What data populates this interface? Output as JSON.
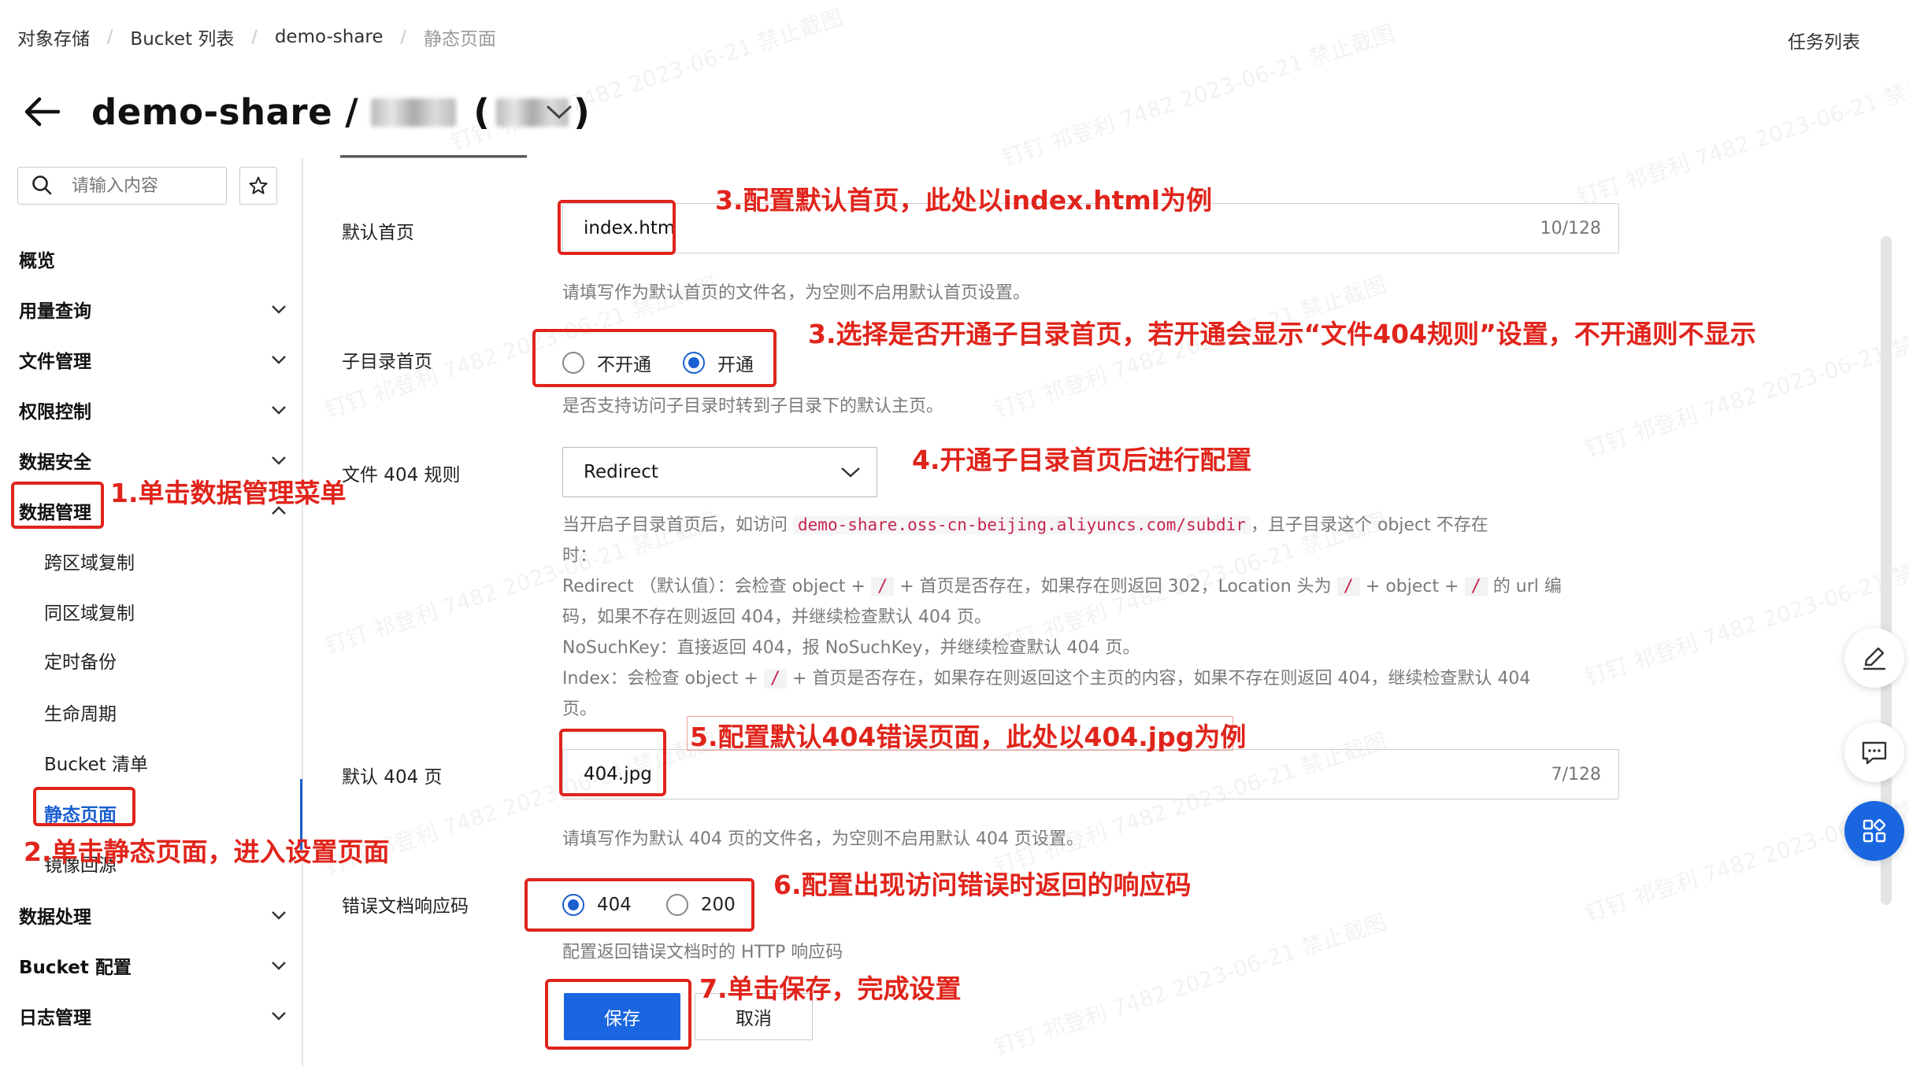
{
  "breadcrumb": {
    "items": [
      "对象存储",
      "Bucket 列表",
      "demo-share",
      "静态页面"
    ]
  },
  "header": {
    "task_list": "任务列表",
    "title": "demo-share /",
    "title_paren_open": "(",
    "title_paren_close": ")"
  },
  "sidebar": {
    "search_placeholder": "请输入内容",
    "items": [
      {
        "label": "概览"
      },
      {
        "label": "用量查询"
      },
      {
        "label": "文件管理"
      },
      {
        "label": "权限控制"
      },
      {
        "label": "数据安全"
      },
      {
        "label": "数据管理"
      },
      {
        "label": "跨区域复制"
      },
      {
        "label": "同区域复制"
      },
      {
        "label": "定时备份"
      },
      {
        "label": "生命周期"
      },
      {
        "label": "Bucket 清单"
      },
      {
        "label": "静态页面"
      },
      {
        "label": "镜像回源"
      },
      {
        "label": "数据处理"
      },
      {
        "label": "Bucket 配置"
      },
      {
        "label": "日志管理"
      }
    ]
  },
  "form": {
    "default_index": {
      "label": "默认首页",
      "value": "index.htm",
      "count": "10/128",
      "help": "请填写作为默认首页的文件名，为空则不启用默认首页设置。"
    },
    "subdir_index": {
      "label": "子目录首页",
      "options": [
        "不开通",
        "开通"
      ],
      "selected": "开通",
      "help": "是否支持访问子目录时转到子目录下的默认主页。"
    },
    "file404_rule": {
      "label": "文件 404 规则",
      "value": "Redirect",
      "desc_intro_a": "当开启子目录首页后，如访问",
      "desc_url": "demo-share.oss-cn-beijing.aliyuncs.com/subdir",
      "desc_intro_b": "，且子目录这个 object 不存在",
      "desc_intro_c": "时：",
      "redirect_a": "Redirect （默认值）：会检查 object +",
      "redirect_b": "+ 首页是否存在，如果存在则返回 302，Location 头为",
      "redirect_c": "+ object +",
      "redirect_d": "的 url 编",
      "redirect_e": "码，如果不存在则返回 404，并继续检查默认 404 页。",
      "slash": "/",
      "nosuchkey": "NoSuchKey：直接返回 404，报 NoSuchKey，并继续检查默认 404 页。",
      "index_a": "Index：会检查 object +",
      "index_b": "+ 首页是否存在，如果存在则返回这个主页的内容，如果不存在则返回 404，继续检查默认 404",
      "index_c": "页。"
    },
    "default_404": {
      "label": "默认 404 页",
      "value": "404.jpg",
      "count": "7/128",
      "help": "请填写作为默认 404 页的文件名，为空则不启用默认 404 页设置。"
    },
    "error_code": {
      "label": "错误文档响应码",
      "options": [
        "404",
        "200"
      ],
      "selected": "404",
      "help": "配置返回错误文档时的 HTTP 响应码"
    },
    "save_label": "保存",
    "cancel_label": "取消"
  },
  "annotations": {
    "step1": "1.单击数据管理菜单",
    "step2": "2.单击静态页面，进入设置页面",
    "step3a": "3.配置默认首页，此处以index.html为例",
    "step3b": "3.选择是否开通子目录首页，若开通会显示“文件404规则”设置，不开通则不显示",
    "step4": "4.开通子目录首页后进行配置",
    "step5": "5.配置默认404错误页面，此处以404.jpg为例",
    "step6": "6.配置出现访问错误时返回的响应码",
    "step7": "7.单击保存，完成设置"
  },
  "watermark": "钉钉 祁登利 7482 2023-06-21 禁止截图",
  "colors": {
    "accent": "#1a66e0",
    "annotation": "#e0241b"
  }
}
